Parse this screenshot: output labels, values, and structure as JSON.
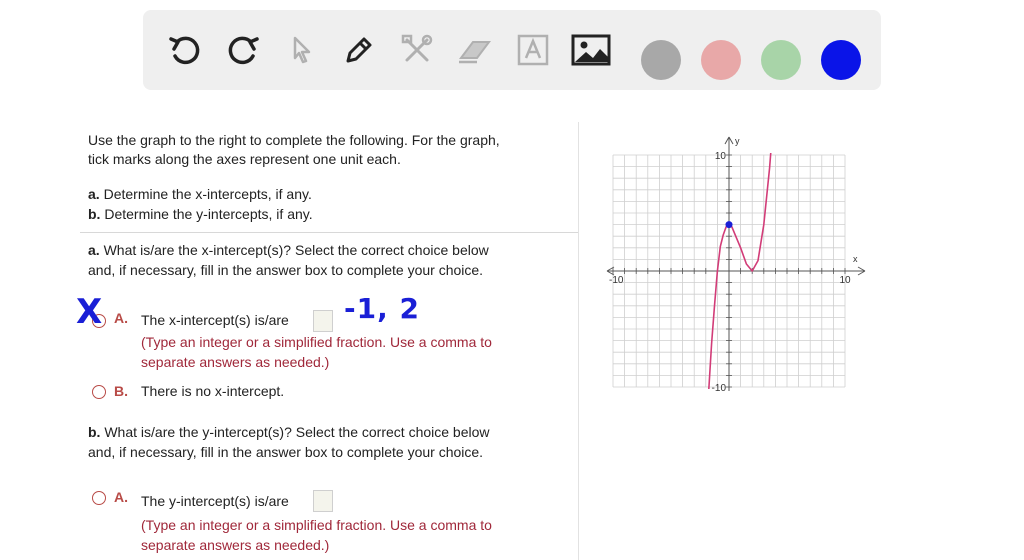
{
  "toolbar": {
    "tools": [
      {
        "name": "undo-icon"
      },
      {
        "name": "redo-icon"
      },
      {
        "name": "pointer-icon"
      },
      {
        "name": "pen-icon"
      },
      {
        "name": "tools-icon"
      },
      {
        "name": "eraser-icon"
      },
      {
        "name": "text-icon"
      },
      {
        "name": "image-icon"
      }
    ],
    "colors": [
      "#a8a8a8",
      "#e8a8a8",
      "#a8d4a8",
      "#0a14e8"
    ]
  },
  "question": {
    "intro_line1": "Use the graph to the right to complete the following. For the graph,",
    "intro_line2": "tick marks along the axes represent one unit each.",
    "part_a_label": "a.",
    "part_a_text": "Determine the x-intercepts, if any.",
    "part_b_label": "b.",
    "part_b_text": "Determine the y-intercepts, if any."
  },
  "section_a": {
    "label": "a.",
    "prompt_line1": "What is/are the x-intercept(s)? Select the correct choice below",
    "prompt_line2": "and, if necessary, fill in the answer box to complete your choice.",
    "choice_a_letter": "A.",
    "choice_a_text": "The x-intercept(s) is/are",
    "choice_a_hint1": "(Type an integer or a simplified fraction. Use a comma to",
    "choice_a_hint2": "separate answers as needed.)",
    "choice_b_letter": "B.",
    "choice_b_text": "There is no x-intercept.",
    "handwritten_mark": "X",
    "handwritten_answer": "-1, 2"
  },
  "section_b": {
    "label": "b.",
    "prompt_line1": "What is/are the y-intercept(s)? Select the correct choice below",
    "prompt_line2": "and, if necessary, fill in the answer box to complete your choice.",
    "choice_a_letter": "A.",
    "choice_a_text": "The y-intercept(s) is/are",
    "choice_a_hint1": "(Type an integer or a simplified fraction. Use a comma to",
    "choice_a_hint2": "separate answers as needed.)"
  },
  "chart_data": {
    "type": "line",
    "x_axis_label": "x",
    "y_axis_label": "y",
    "xlim": [
      -10,
      10
    ],
    "ylim": [
      -10,
      10
    ],
    "x_tick_labels": [
      "-10",
      "10"
    ],
    "y_tick_labels": [
      "10",
      "-10"
    ],
    "grid": true,
    "curve_color": "#d23c78",
    "point_color": "#1a1fd6",
    "series": [
      {
        "x": [
          -1.8,
          -1.5,
          -1.25,
          -1,
          -0.75,
          -0.5,
          -0.25,
          0,
          0.25,
          0.5,
          1,
          1.5,
          2,
          2.5,
          3,
          3.5,
          3.8
        ],
        "y": [
          -11.2,
          -6.25,
          -3.0,
          0,
          2.1,
          3.1,
          3.8,
          4,
          3.8,
          3.2,
          2.0,
          0.6,
          0,
          0.9,
          4.0,
          8.9,
          12.8
        ]
      }
    ],
    "highlight_point": {
      "x": 0,
      "y": 4
    }
  }
}
